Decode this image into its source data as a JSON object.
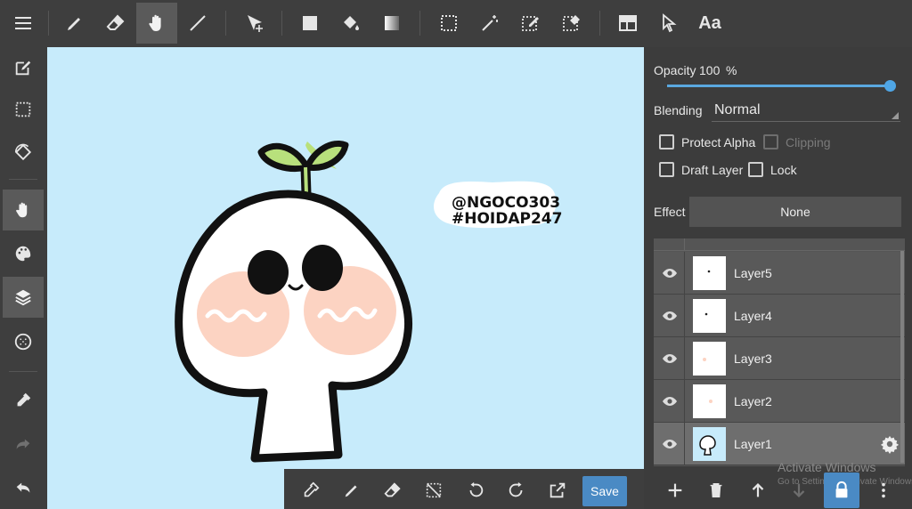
{
  "top_toolbar": {
    "tools": [
      "pen-icon",
      "eraser-icon",
      "hand-icon",
      "line-icon",
      "move-icon",
      "fill-rect-icon",
      "bucket-icon",
      "gradient-icon",
      "select-rect-icon",
      "magic-wand-icon",
      "select-pen-icon",
      "select-eraser-icon",
      "panel-icon",
      "pointer-icon"
    ],
    "active_tool": "hand",
    "text_tool_label": "Aa"
  },
  "left_sidebar": {
    "items": [
      "menu-icon",
      "edit-icon",
      "selection-icon",
      "rotate-icon",
      "hand-icon",
      "palette-icon",
      "layers-icon",
      "grid-icon",
      "eyedropper-icon",
      "redo-icon",
      "undo-icon"
    ],
    "active": [
      "hand",
      "layers"
    ]
  },
  "canvas": {
    "background": "#c7ebfb",
    "sticker_line1": "@NGOCO303",
    "sticker_line2": "#HOIDAP247"
  },
  "bottom_toolbar": {
    "save_label": "Save"
  },
  "layer_panel": {
    "opacity_label": "Opacity",
    "opacity_value": "100",
    "opacity_unit": "%",
    "opacity_fraction": 1.0,
    "blending_label": "Blending",
    "blending_value": "Normal",
    "protect_alpha_label": "Protect Alpha",
    "clipping_label": "Clipping",
    "draft_layer_label": "Draft Layer",
    "lock_label": "Lock",
    "effect_label": "Effect",
    "effect_value": "None",
    "layers": [
      {
        "name": "Layer5",
        "selected": false
      },
      {
        "name": "Layer4",
        "selected": false
      },
      {
        "name": "Layer3",
        "selected": false
      },
      {
        "name": "Layer2",
        "selected": false
      },
      {
        "name": "Layer1",
        "selected": true
      }
    ]
  },
  "watermark": {
    "line1": "Activate Windows",
    "line2": "Go to Settings to activate Windows."
  },
  "colors": {
    "accent": "#4a8ac4",
    "panel": "#3c3c3c",
    "canvas": "#c7ebfb"
  }
}
